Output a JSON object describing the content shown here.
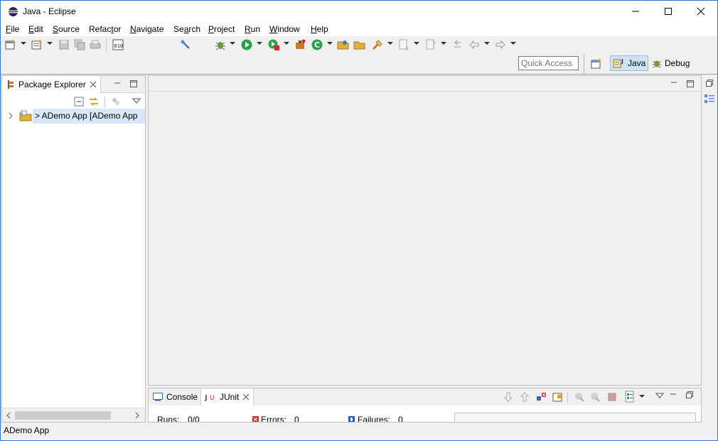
{
  "window": {
    "title": "Java - Eclipse"
  },
  "menu": [
    {
      "first": "F",
      "rest": "ile"
    },
    {
      "first": "E",
      "rest": "dit"
    },
    {
      "first": "S",
      "rest": "ource"
    },
    {
      "pre": "Refac",
      "first": "t",
      "rest": "or"
    },
    {
      "first": "N",
      "rest": "avigate"
    },
    {
      "pre": "Se",
      "first": "a",
      "rest": "rch"
    },
    {
      "first": "P",
      "rest": "roject"
    },
    {
      "first": "R",
      "rest": "un"
    },
    {
      "first": "W",
      "rest": "indow"
    },
    {
      "first": "H",
      "rest": "elp"
    }
  ],
  "quick_access": {
    "placeholder": "Quick Access"
  },
  "perspectives": {
    "java": "Java",
    "debug": "Debug"
  },
  "package_explorer": {
    "title": "Package Explorer",
    "tree_item": "> ADemo App  [ADemo App"
  },
  "bottom_tabs": {
    "console": "Console",
    "junit": "JUnit"
  },
  "junit": {
    "runs_label": "Runs:",
    "runs_value": "0/0",
    "errors_label": "Errors:",
    "errors_value": "0",
    "failures_label": "Failures:",
    "failures_value": "0"
  },
  "status": {
    "text": "ADemo App"
  },
  "colors": {
    "accent": "#2b79d0",
    "active_perspective": "#cfe3f6",
    "error": "#d12a2a"
  }
}
